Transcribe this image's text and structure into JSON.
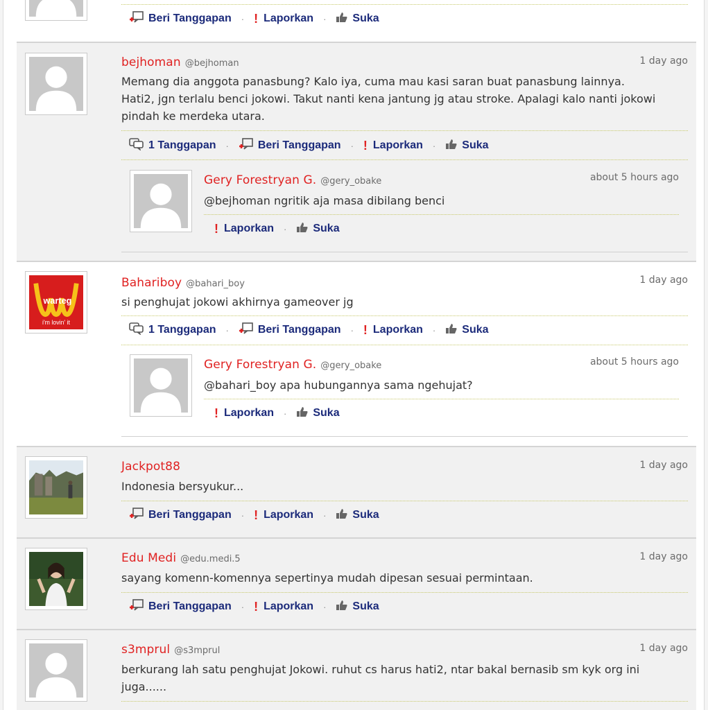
{
  "labels": {
    "reply": "Beri Tanggapan",
    "report": "Laporkan",
    "like": "Suka",
    "reply_count": "1 Tanggapan",
    "separator": "·"
  },
  "comments": [
    {
      "id": "bejhoman",
      "name": "bejhoman",
      "handle": "@bejhoman",
      "time": "1 day ago",
      "lines": [
        "Memang dia anggota panasbung? Kalo iya, cuma mau kasi saran buat panasbung lainnya.",
        "Hati2, jgn terlalu benci jokowi. Takut nanti kena jantung jg atau stroke. Apalagi kalo nanti jokowi",
        "pindah ke merdeka utara."
      ],
      "reply": {
        "name": "Gery Forestryan G.",
        "handle": "@gery_obake",
        "time": "about 5 hours ago",
        "text": "@bejhoman ngritik aja masa dibilang benci"
      }
    },
    {
      "id": "bahariboy",
      "name": "Bahariboy",
      "handle": "@bahari_boy",
      "time": "1 day ago",
      "avatar_text": [
        "warteg",
        "i'm lovin' it"
      ],
      "lines": [
        "si penghujat jokowi akhirnya gameover jg"
      ],
      "reply": {
        "name": "Gery Forestryan G.",
        "handle": "@gery_obake",
        "time": "about 5 hours ago",
        "text": "@bahari_boy apa hubungannya sama ngehujat?"
      }
    },
    {
      "id": "jackpot88",
      "name": "Jackpot88",
      "handle": "",
      "time": "1 day ago",
      "lines": [
        "Indonesia bersyukur..."
      ]
    },
    {
      "id": "edumedi",
      "name": "Edu Medi",
      "handle": "@edu.medi.5",
      "time": "1 day ago",
      "lines": [
        "sayang komenn-komennya sepertinya mudah dipesan sesuai permintaan."
      ]
    },
    {
      "id": "s3mprul",
      "name": "s3mprul",
      "handle": "@s3mprul",
      "time": "1 day ago",
      "lines": [
        "berkurang lah satu penghujat Jokowi. ruhut cs harus hati2, ntar bakal bernasib sm kyk org ini",
        "juga......"
      ]
    }
  ],
  "colors": {
    "username": "#e02222",
    "action": "#1b2a7a",
    "gray_block": "#f1f1f1",
    "dotted": "#c7c96a"
  },
  "icons": [
    "reply-icon",
    "comments-icon",
    "report-icon",
    "thumbs-up-icon",
    "default-avatar-icon"
  ]
}
